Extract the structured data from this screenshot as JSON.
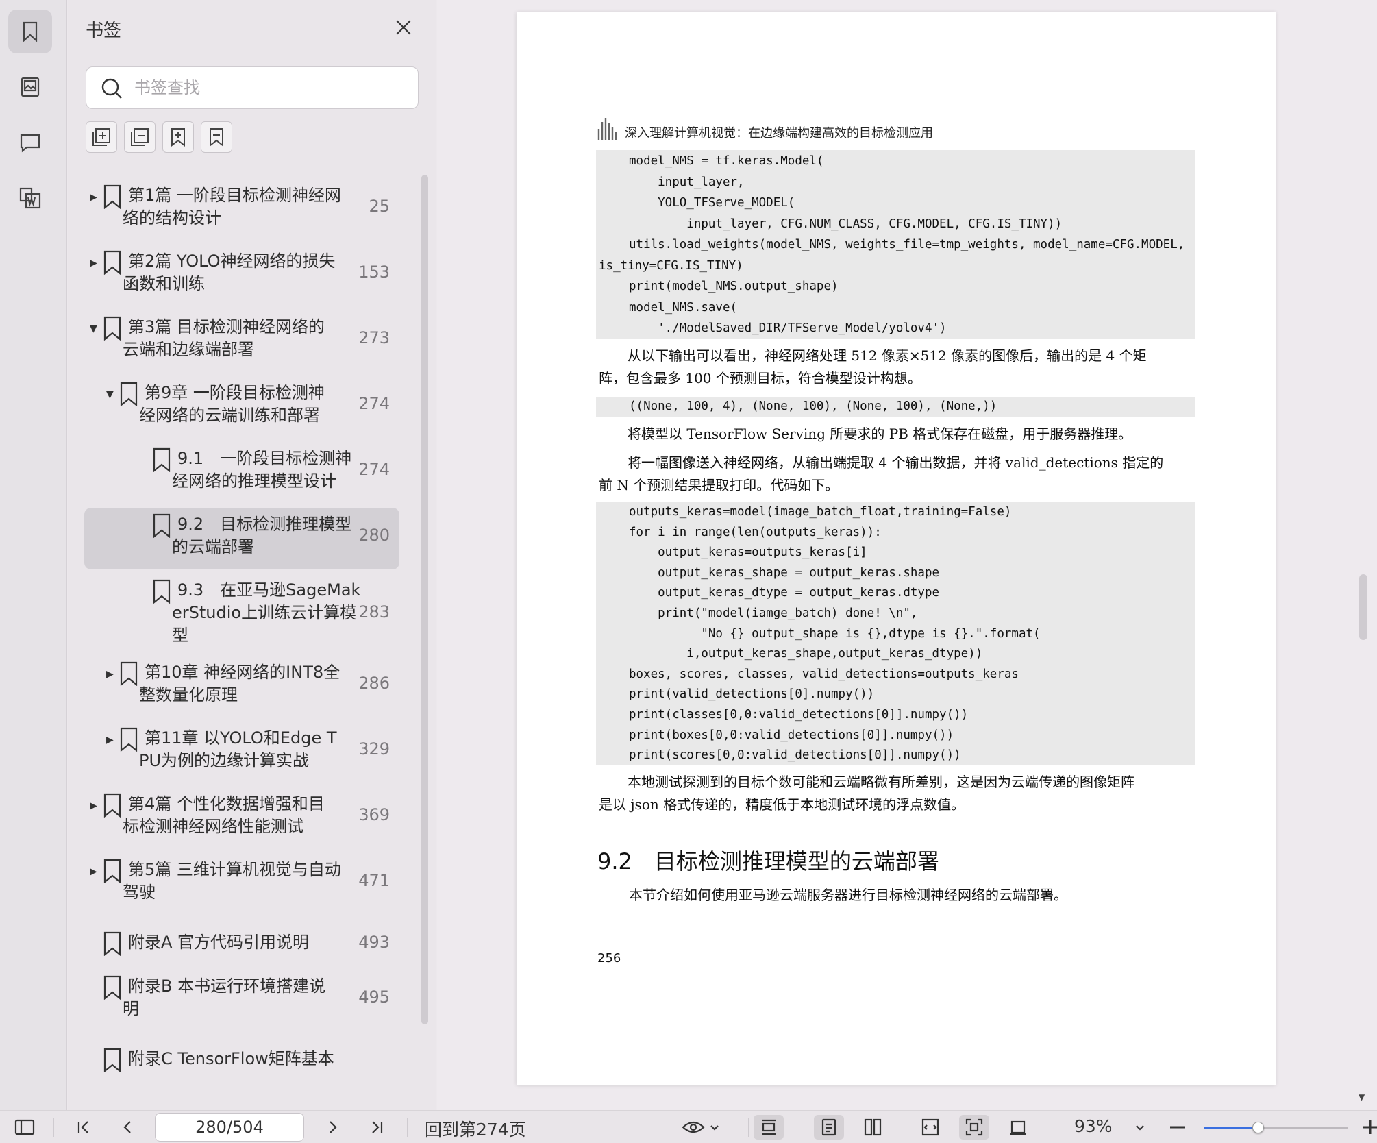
{
  "rail": {
    "items": [
      {
        "name": "bookmark-icon",
        "active": true
      },
      {
        "name": "image-icon",
        "active": false
      },
      {
        "name": "comment-icon",
        "active": false
      },
      {
        "name": "word-export-icon",
        "active": false
      }
    ]
  },
  "panel": {
    "title": "书签",
    "search_placeholder": "书签查找",
    "tools": [
      "expand-all-icon",
      "collapse-all-icon",
      "add-bookmark-icon",
      "bookmark-outline-icon"
    ],
    "bookmarks": [
      {
        "title_lines": [
          "第1篇 一阶段目标检测神经网",
          "络的结构设计"
        ],
        "page": "25",
        "level": 0,
        "expander": "collapsed"
      },
      {
        "title_lines": [
          "第2篇 YOLO神经网络的损失",
          "函数和训练"
        ],
        "page": "153",
        "level": 0,
        "expander": "collapsed"
      },
      {
        "title_lines": [
          "第3篇 目标检测神经网络的",
          "云端和边缘端部署"
        ],
        "page": "273",
        "level": 0,
        "expander": "expanded"
      },
      {
        "title_lines": [
          "第9章 一阶段目标检测神",
          "经网络的云端训练和部署"
        ],
        "page": "274",
        "level": 1,
        "expander": "expanded"
      },
      {
        "title_lines": [
          "9.1　一阶段目标检测神",
          "经网络的推理模型设计"
        ],
        "page": "274",
        "level": 2,
        "expander": "none"
      },
      {
        "title_lines": [
          "9.2　目标检测推理模型",
          "的云端部署"
        ],
        "page": "280",
        "level": 2,
        "expander": "none",
        "selected": true
      },
      {
        "title_lines": [
          "9.3　在亚马逊SageMak",
          "erStudio上训练云计算模",
          "型"
        ],
        "page": "283",
        "level": 2,
        "expander": "none"
      },
      {
        "title_lines": [
          "第10章 神经网络的INT8全",
          "整数量化原理"
        ],
        "page": "286",
        "level": 1,
        "expander": "collapsed"
      },
      {
        "title_lines": [
          "第11章 以YOLO和Edge T",
          "PU为例的边缘计算实战"
        ],
        "page": "329",
        "level": 1,
        "expander": "collapsed"
      },
      {
        "title_lines": [
          "第4篇 个性化数据增强和目",
          "标检测神经网络性能测试"
        ],
        "page": "369",
        "level": 0,
        "expander": "collapsed"
      },
      {
        "title_lines": [
          "第5篇 三维计算机视觉与自动",
          "驾驶"
        ],
        "page": "471",
        "level": 0,
        "expander": "collapsed"
      },
      {
        "title_lines": [
          "附录A 官方代码引用说明"
        ],
        "page": "493",
        "level": 0,
        "expander": "none"
      },
      {
        "title_lines": [
          "附录B 本书运行环境搭建说",
          "明"
        ],
        "page": "495",
        "level": 0,
        "expander": "none"
      },
      {
        "title_lines": [
          "附录C TensorFlow矩阵基本"
        ],
        "page": "",
        "level": 0,
        "expander": "none"
      }
    ]
  },
  "document": {
    "running_header": "深入理解计算机视觉：在边缘端构建高效的目标检测应用",
    "code_block_1": [
      "model_NMS = tf.keras.Model(",
      "    input_layer,",
      "    YOLO_TFServe_MODEL(",
      "        input_layer, CFG.NUM_CLASS, CFG.MODEL, CFG.IS_TINY))",
      "utils.load_weights(model_NMS, weights_file=tmp_weights, model_name=CFG.MODEL,",
      "is_tiny=CFG.IS_TINY)",
      "print(model_NMS.output_shape)",
      "model_NMS.save(",
      "    './ModelSaved_DIR/TFServe_Model/yolov4')"
    ],
    "para_1": [
      "从以下输出可以看出，神经网络处理 512 像素×512 像素的图像后，输出的是 4 个矩",
      "阵，包含最多 100 个预测目标，符合模型设计构想。"
    ],
    "code_block_2": [
      "((None, 100, 4), (None, 100), (None, 100), (None,))"
    ],
    "para_2": [
      "将模型以 TensorFlow Serving 所要求的 PB 格式保存在磁盘，用于服务器推理。"
    ],
    "para_3": [
      "将一幅图像送入神经网络，从输出端提取 4 个输出数据，并将 valid_detections 指定的",
      "前 N 个预测结果提取打印。代码如下。"
    ],
    "code_block_3": [
      "outputs_keras=model(image_batch_float,training=False)",
      "for i in range(len(outputs_keras)):",
      "    output_keras=outputs_keras[i]",
      "    output_keras_shape = output_keras.shape",
      "    output_keras_dtype = output_keras.dtype",
      "    print(\"model(iamge_batch) done! \\n\",",
      "          \"No {} output_shape is {},dtype is {}.\".format(",
      "        i,output_keras_shape,output_keras_dtype))",
      "boxes, scores, classes, valid_detections=outputs_keras",
      "print(valid_detections[0].numpy())",
      "print(classes[0,0:valid_detections[0]].numpy())",
      "print(boxes[0,0:valid_detections[0]].numpy())",
      "print(scores[0,0:valid_detections[0]].numpy())"
    ],
    "para_4": [
      "本地测试探测到的目标个数可能和云端略微有所差别，这是因为云端传递的图像矩阵",
      "是以 json 格式传递的，精度低于本地测试环境的浮点数值。"
    ],
    "section_heading": "9.2　目标检测推理模型的云端部署",
    "para_5": [
      "本节介绍如何使用亚马逊云端服务器进行目标检测神经网络的云端部署。"
    ],
    "page_number": "256"
  },
  "toolbar": {
    "page_field": "280/504",
    "back_link": "回到第274页",
    "zoom": "93%",
    "zoom_fraction": 0.37,
    "accent": "#3b6fe0"
  }
}
